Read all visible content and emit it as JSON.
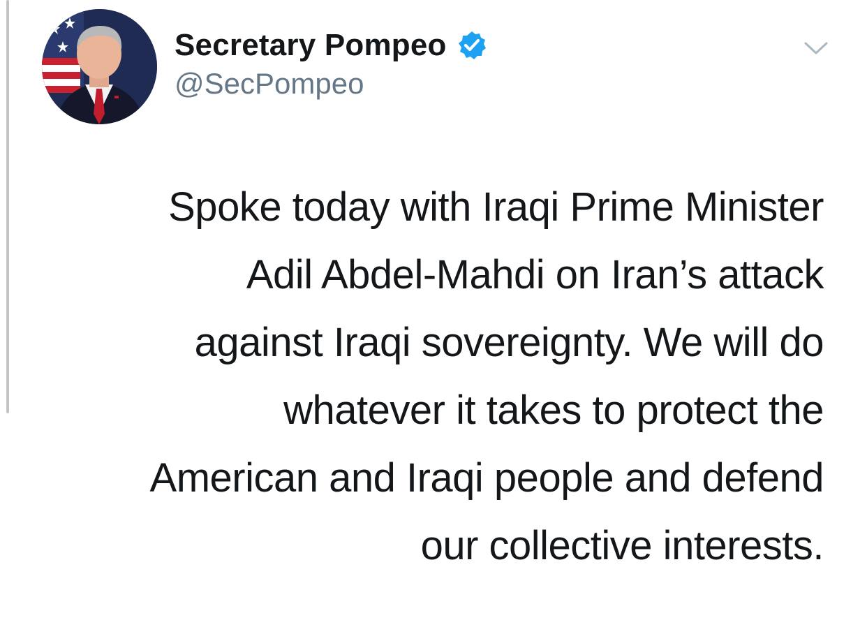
{
  "author": {
    "display_name": "Secretary Pompeo",
    "handle": "@SecPompeo",
    "verified": true,
    "avatar_icon": "profile-photo"
  },
  "menu": {
    "icon": "chevron-down-icon"
  },
  "tweet": {
    "lines": [
      "Spoke today with Iraqi Prime Minister",
      "Adil Abdel-Mahdi on Iran’s attack",
      "against Iraqi sovereignty. We will do",
      "whatever it takes to protect the",
      "American and Iraqi people and defend",
      "our collective interests."
    ]
  },
  "colors": {
    "text": "#14171a",
    "secondary": "#657786",
    "verified_blue": "#1da1f2",
    "caret": "#aab8c2"
  }
}
